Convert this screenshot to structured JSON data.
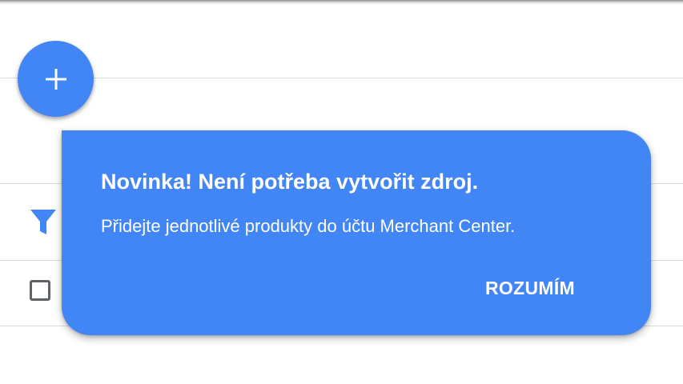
{
  "fab": {
    "icon": "plus-icon",
    "color": "#4285f4"
  },
  "toolbar": {
    "filter_icon": "filter-icon",
    "filter_color": "#4285f4"
  },
  "table": {
    "select_checkbox_checked": false
  },
  "tooltip": {
    "title": "Novinka! Není potřeba vytvořit zdroj.",
    "body": "Přidejte jednotlivé produkty do účtu Merchant Center.",
    "action_label": "ROZUMÍM",
    "background_color": "#4285f4",
    "text_color": "#ffffff"
  }
}
